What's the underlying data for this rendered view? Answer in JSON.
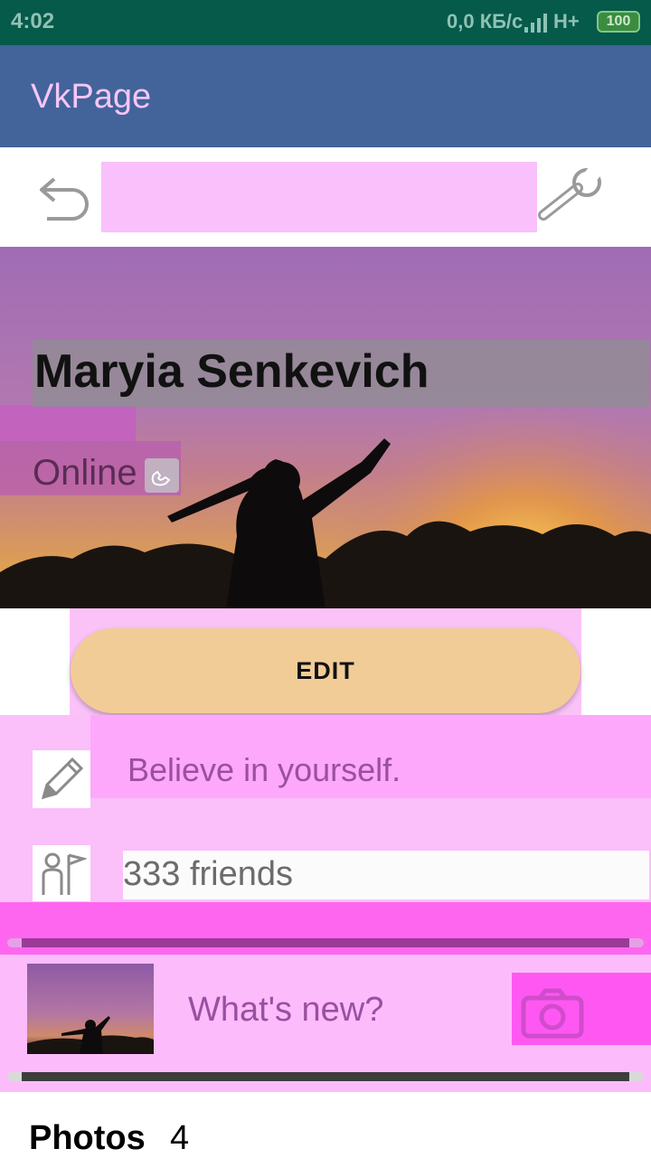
{
  "status_bar": {
    "time": "4:02",
    "network_speed": "0,0 КБ/с",
    "network_type": "H+",
    "battery": "100"
  },
  "app_bar": {
    "title": "VkPage"
  },
  "toolbar": {
    "back_icon": "back-arrow-icon",
    "settings_icon": "wrench-icon"
  },
  "profile": {
    "name": "Maryia Senkevich",
    "status": "Online",
    "status_icon": "phone-icon"
  },
  "edit_button": {
    "label": "EDIT"
  },
  "info": {
    "quote": "Believe in yourself.",
    "quote_icon": "pencil-icon",
    "friends": "333 friends",
    "friends_icon": "friends-icon"
  },
  "composer": {
    "placeholder": "What's new?",
    "camera_icon": "camera-icon"
  },
  "photos": {
    "label": "Photos",
    "count": "4"
  },
  "colors": {
    "app_bar": "#42649a",
    "status_bar": "#055a4a",
    "edit_button": "#f1cc96"
  }
}
